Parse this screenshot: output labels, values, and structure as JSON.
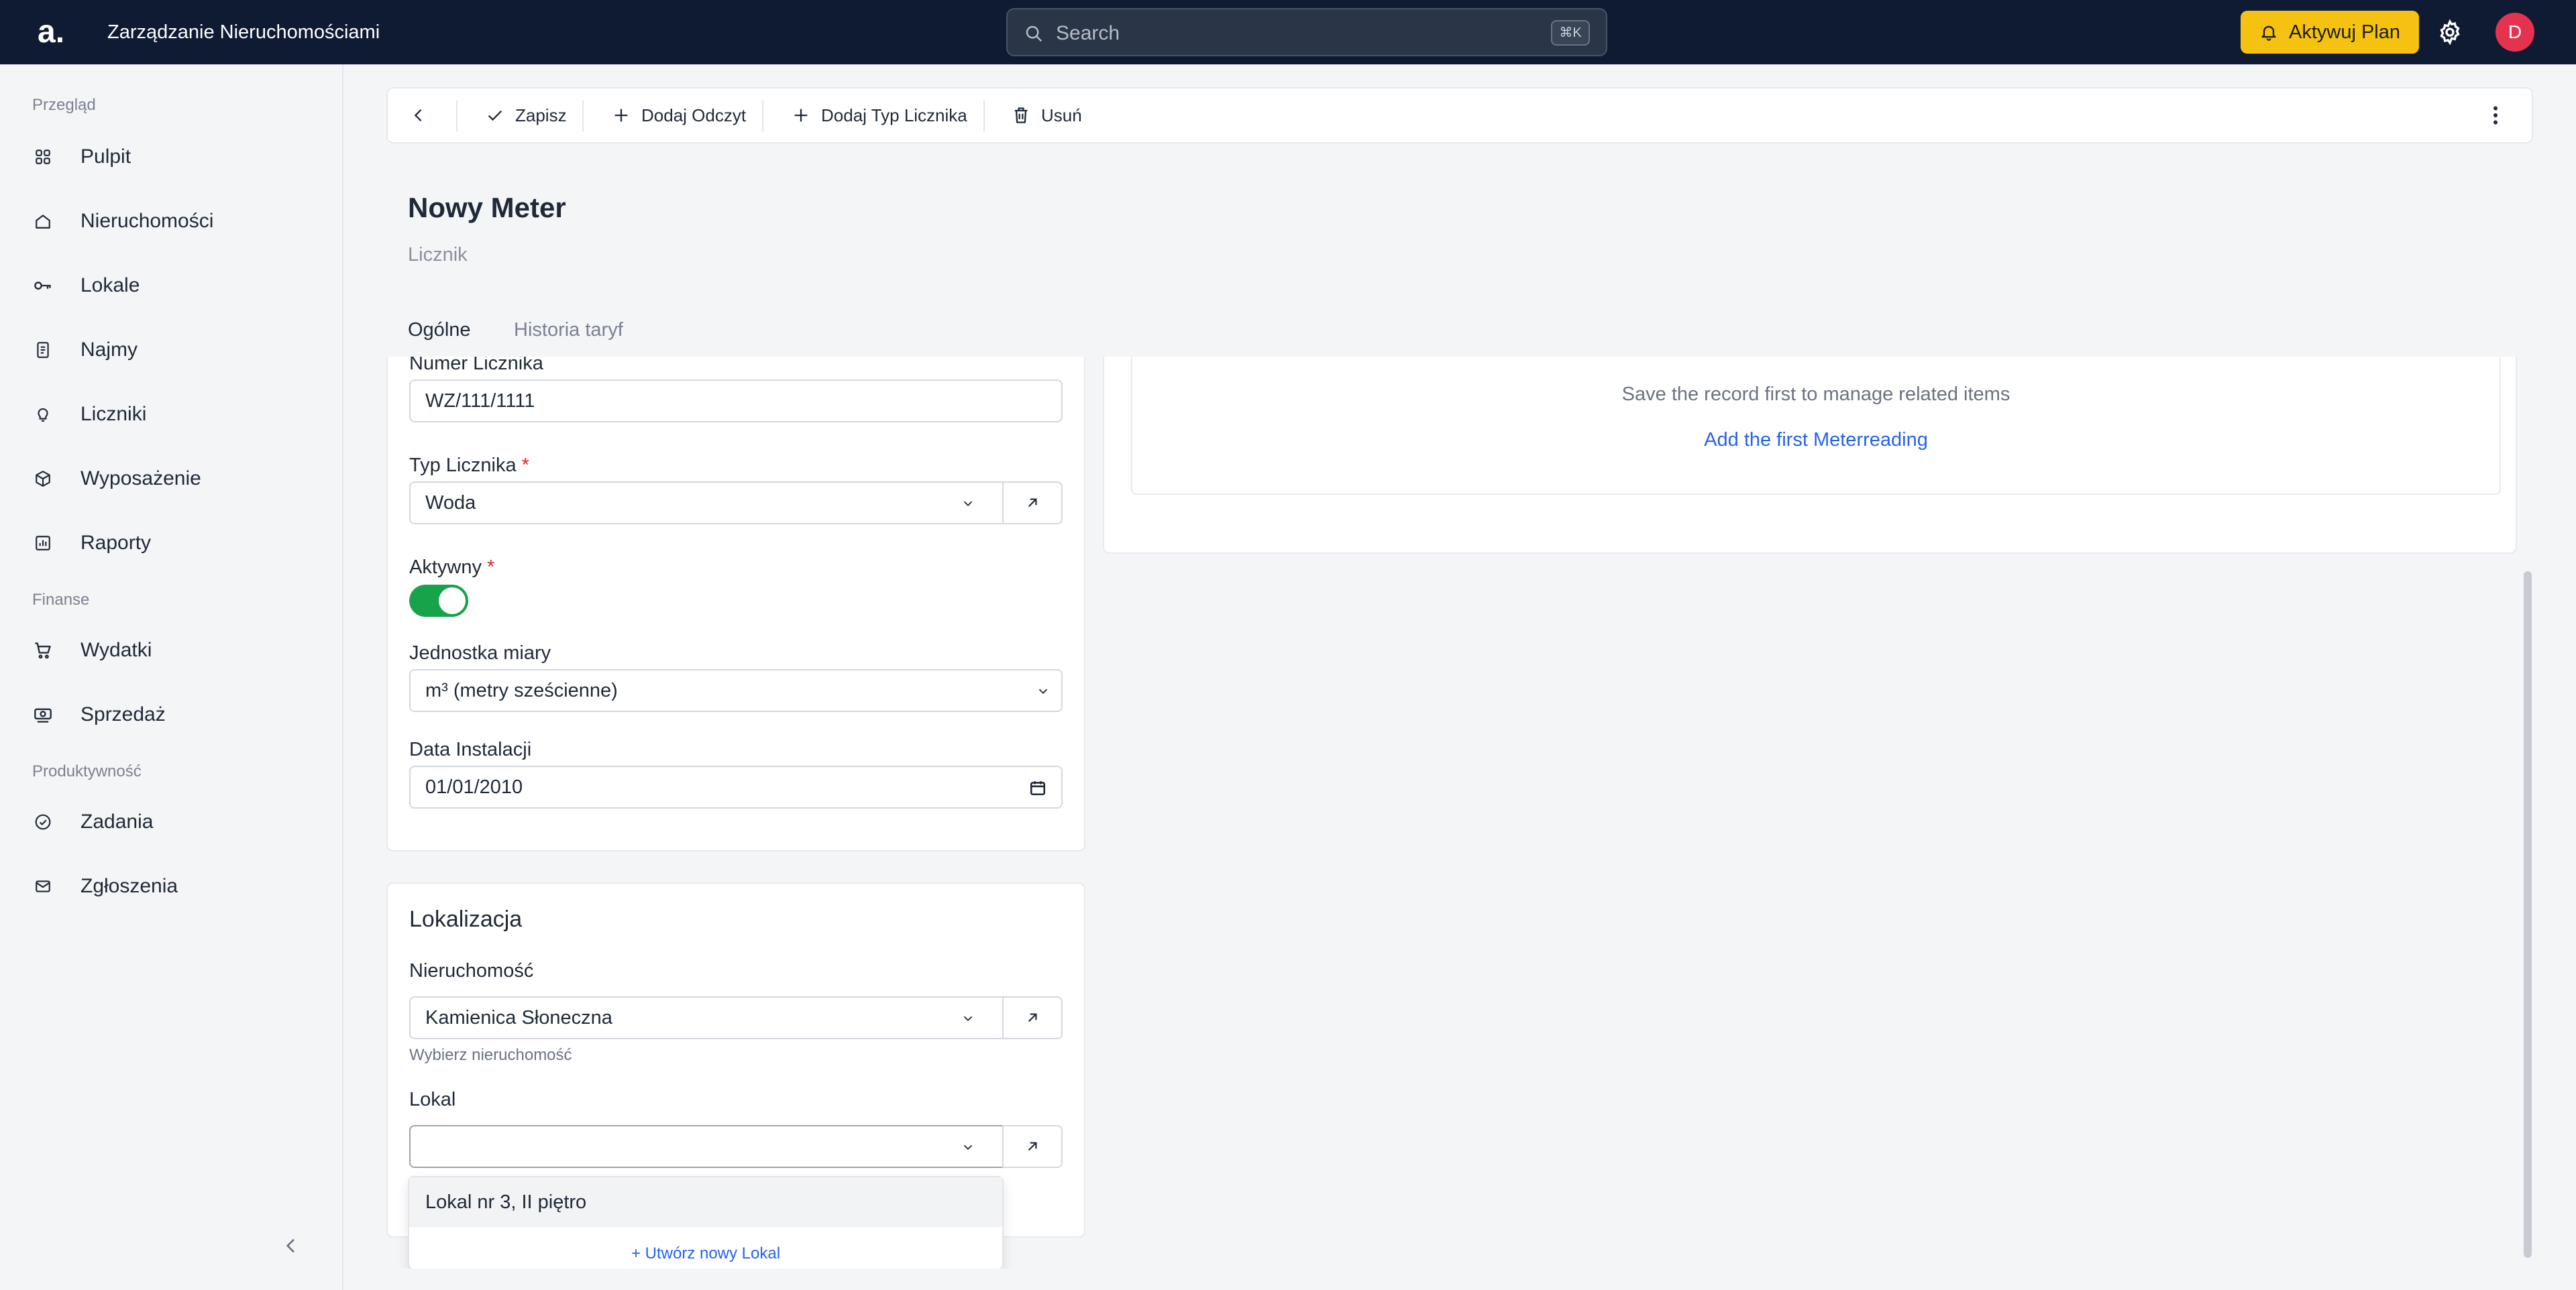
{
  "app": {
    "logo": "a.",
    "title": "Zarządzanie Nieruchomościami"
  },
  "search": {
    "placeholder": "Search",
    "shortcut": "⌘K"
  },
  "header": {
    "upgrade_label": "Aktywuj Plan",
    "avatar_initial": "D"
  },
  "sidebar": {
    "sections": [
      {
        "label": "Przegląd"
      },
      {
        "label": "Finanse"
      },
      {
        "label": "Produktywność"
      }
    ],
    "items": [
      {
        "label": "Pulpit",
        "icon": "dashboard-icon"
      },
      {
        "label": "Nieruchomości",
        "icon": "home-icon"
      },
      {
        "label": "Lokale",
        "icon": "key-icon"
      },
      {
        "label": "Najmy",
        "icon": "document-icon"
      },
      {
        "label": "Liczniki",
        "icon": "lightbulb-icon"
      },
      {
        "label": "Wyposażenie",
        "icon": "box-icon"
      },
      {
        "label": "Raporty",
        "icon": "report-icon"
      },
      {
        "label": "Wydatki",
        "icon": "cart-icon"
      },
      {
        "label": "Sprzedaż",
        "icon": "cash-icon"
      },
      {
        "label": "Zadania",
        "icon": "check-circle-icon"
      },
      {
        "label": "Zgłoszenia",
        "icon": "mail-icon"
      }
    ]
  },
  "toolbar": {
    "save_label": "Zapisz",
    "add_reading_label": "Dodaj Odczyt",
    "add_meter_type_label": "Dodaj Typ Licznika",
    "delete_label": "Usuń"
  },
  "page": {
    "title": "Nowy Meter",
    "subtitle": "Licznik"
  },
  "tabs": [
    {
      "label": "Ogólne",
      "active": true
    },
    {
      "label": "Historia taryf",
      "active": false
    }
  ],
  "form": {
    "meter_number": {
      "label": "Numer Licznika",
      "value": "WZ/111/1111"
    },
    "meter_type": {
      "label": "Typ Licznika",
      "value": "Woda",
      "required_mark": "*"
    },
    "active": {
      "label": "Aktywny",
      "value": true,
      "required_mark": "*"
    },
    "unit": {
      "label": "Jednostka miary",
      "value": "m³ (metry sześcienne)"
    },
    "install_date": {
      "label": "Data Instalacji",
      "value": "01/01/2010"
    }
  },
  "location": {
    "title": "Lokalizacja",
    "property": {
      "label": "Nieruchomość",
      "value": "Kamienica Słoneczna",
      "helper": "Wybierz nieruchomość"
    },
    "unit": {
      "label": "Lokal",
      "value": ""
    },
    "dropdown": {
      "options": [
        "Lokal nr 3, II piętro"
      ],
      "create_label": "+ Utwórz nowy Lokal"
    }
  },
  "related": {
    "empty_message": "Save the record first to manage related items",
    "add_first_label": "Add the first Meterreading"
  },
  "colors": {
    "topbar": "#0f1b33",
    "accent_yellow": "#f5c211",
    "toggle_on": "#16a34a",
    "link_blue": "#2563eb",
    "avatar": "#e5324e",
    "required": "#dc2626"
  }
}
